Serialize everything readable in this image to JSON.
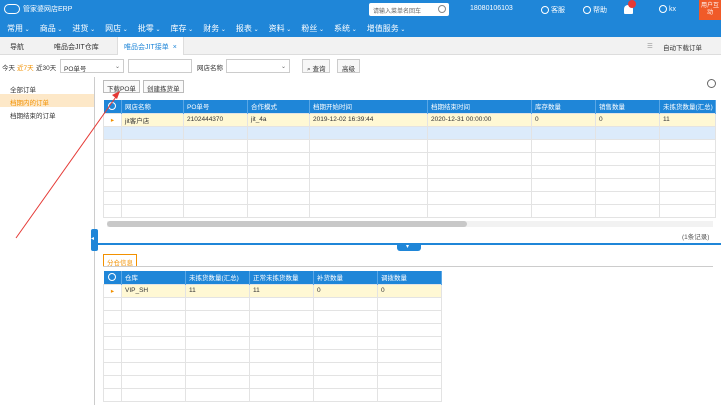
{
  "app": {
    "logo_text": "管家婆网店ERP",
    "search_placeholder": "请输入菜单名回车",
    "phone": "18080106103",
    "service_label": "客服",
    "help_label": "帮助",
    "user_label": "kx",
    "user_box_label": "用户互动"
  },
  "menu": [
    "常用",
    "商品",
    "进货",
    "网店",
    "批零",
    "库存",
    "财务",
    "报表",
    "资料",
    "粉丝",
    "系统",
    "增值服务"
  ],
  "tabs": {
    "nav": "导航",
    "tab1": "唯品会JIT仓库",
    "tab2": "唯品会JIT接单",
    "right_btn": "自动下载订单"
  },
  "filter": {
    "today": "今天",
    "last7": "近7天",
    "last30": "近30天",
    "po_select": "PO单号",
    "shop_label": "网店名称",
    "search_btn": "查询",
    "advanced_btn": "高级"
  },
  "left": {
    "items": [
      "全部订单",
      "档期内的订单",
      "档期结束的订单"
    ]
  },
  "actions": {
    "download_po": "下载PO单",
    "create_pick": "创建拣货单"
  },
  "grid_top": {
    "headers": [
      "网店名称",
      "PO单号",
      "合作模式",
      "档期开始时间",
      "档期结束时间",
      "库存数量",
      "销售数量",
      "未拣货数量(汇总)"
    ],
    "rows": [
      [
        "jit客户店",
        "2102444370",
        "jit_4a",
        "2019-12-02 16:39:44",
        "2020-12-31 00:00:00",
        "0",
        "0",
        "11"
      ]
    ],
    "records": "(1条记录)"
  },
  "detail": {
    "tab_label": "分仓信息"
  },
  "grid_bottom": {
    "headers": [
      "仓库",
      "未拣货数量(汇总)",
      "正常未拣货数量",
      "补货数量",
      "调拨数量"
    ],
    "rows": [
      [
        "VIP_SH",
        "11",
        "11",
        "0",
        "0"
      ]
    ]
  },
  "colors": {
    "primary": "#1f86d8",
    "accent": "#f29100",
    "alert": "#e53935",
    "selected_row": "#fff8d4"
  }
}
